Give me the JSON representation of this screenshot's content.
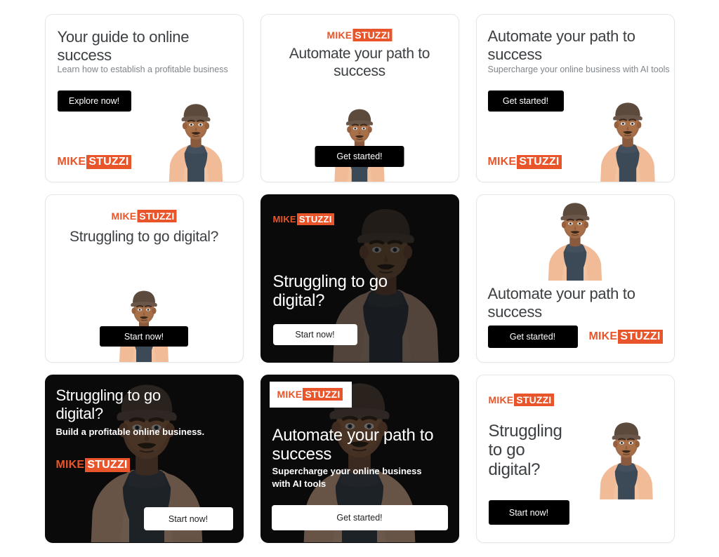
{
  "brand": {
    "logo_part1": "MIKE",
    "logo_part2": "STUZZI",
    "accent_color": "#e8552b",
    "dark_color": "#0a0a0a",
    "light_color": "#ffffff"
  },
  "cards": [
    {
      "id": "card-1",
      "theme": "light",
      "headline": "Your guide to online success",
      "subtitle": "Learn how to establish a profitable business",
      "cta": "Explore now!"
    },
    {
      "id": "card-2",
      "theme": "light",
      "headline": "Automate your path to success",
      "subtitle": "",
      "cta": "Get started!"
    },
    {
      "id": "card-3",
      "theme": "light",
      "headline": "Automate your path to success",
      "subtitle": "Supercharge your online business with AI tools",
      "cta": "Get started!"
    },
    {
      "id": "card-4",
      "theme": "light",
      "headline": "Struggling to go digital?",
      "subtitle": "",
      "cta": "Start now!"
    },
    {
      "id": "card-5",
      "theme": "dark",
      "headline": "Struggling to go digital?",
      "subtitle": "",
      "cta": "Start now!"
    },
    {
      "id": "card-6",
      "theme": "light",
      "headline": "Automate your path to success",
      "subtitle": "",
      "cta": "Get started!"
    },
    {
      "id": "card-7",
      "theme": "dark",
      "headline": "Struggling to go digital?",
      "subtitle": "Build a profitable online business.",
      "cta": "Start now!"
    },
    {
      "id": "card-8",
      "theme": "dark",
      "headline": "Automate your path to success",
      "subtitle": "Supercharge your online business with AI tools",
      "cta": "Get started!"
    },
    {
      "id": "card-9",
      "theme": "light",
      "headline": "Struggling to go digital?",
      "subtitle": "",
      "cta": "Start now!"
    }
  ]
}
